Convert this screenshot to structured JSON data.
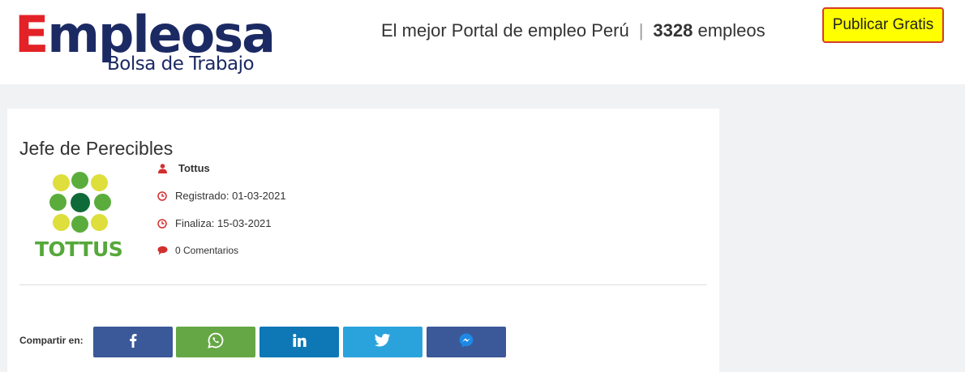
{
  "header": {
    "logo": {
      "letter": "E",
      "rest": "mpleosa",
      "subtitle": "Bolsa de Trabajo"
    },
    "tagline": {
      "text": "El mejor Portal de empleo Perú",
      "separator": "|",
      "count": "3328",
      "count_suffix": "empleos"
    },
    "publish_label": "Publicar Gratis"
  },
  "job": {
    "title": "Jefe de Perecibles",
    "company_logo_text": "TOTTUS",
    "company": "Tottus",
    "registered": "Registrado: 01-03-2021",
    "ends": "Finaliza: 15-03-2021",
    "comments": "0 Comentarios"
  },
  "share": {
    "label": "Compartir en:",
    "buttons": [
      {
        "network": "facebook",
        "icon": "facebook-icon",
        "color": "#3b5998"
      },
      {
        "network": "whatsapp",
        "icon": "whatsapp-icon",
        "color": "#65a745"
      },
      {
        "network": "linkedin",
        "icon": "linkedin-icon",
        "color": "#0e77b5"
      },
      {
        "network": "twitter",
        "icon": "twitter-icon",
        "color": "#2aa3dc"
      },
      {
        "network": "messenger",
        "icon": "messenger-icon",
        "color": "#3b5998"
      }
    ]
  },
  "colors": {
    "accent_red": "#e32227",
    "brand_navy": "#1c2a64",
    "publish_yellow": "#ffff00",
    "icon_red": "#d32f2f"
  }
}
